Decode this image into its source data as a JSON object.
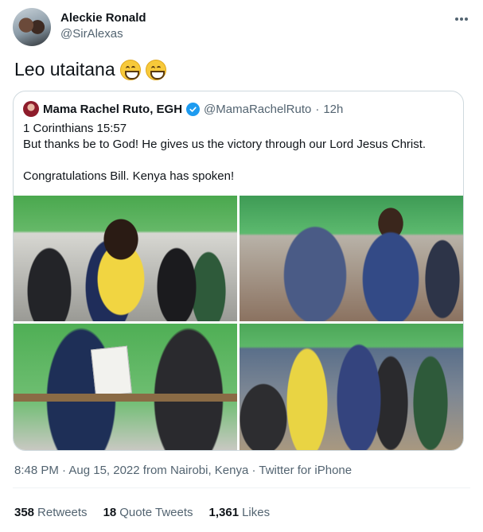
{
  "author": {
    "display_name": "Aleckie Ronald",
    "handle": "@SirAlexas"
  },
  "tweet": {
    "text": "Leo utaitana",
    "emoji": [
      "grinning-face",
      "grinning-face"
    ]
  },
  "quoted": {
    "display_name": "Mama Rachel Ruto, EGH",
    "handle": "@MamaRachelRuto",
    "separator": "·",
    "time": "12h",
    "lines": [
      "1 Corinthians 15:57",
      "But thanks be to God! He gives us the victory through our Lord Jesus Christ.",
      "Congratulations Bill. Kenya has spoken!"
    ],
    "photos": [
      "photo-1",
      "photo-2",
      "photo-3",
      "photo-4"
    ]
  },
  "meta": {
    "timestamp": "8:48 PM · Aug 15, 2022 from Nairobi, Kenya · Twitter for iPhone"
  },
  "stats": {
    "retweets_count": "358",
    "retweets_label": "Retweets",
    "quotes_count": "18",
    "quotes_label": "Quote Tweets",
    "likes_count": "1,361",
    "likes_label": "Likes"
  },
  "colors": {
    "text_primary": "#0f1419",
    "text_secondary": "#536471",
    "verified_blue": "#1d9bf0",
    "border": "#cfd9de"
  }
}
